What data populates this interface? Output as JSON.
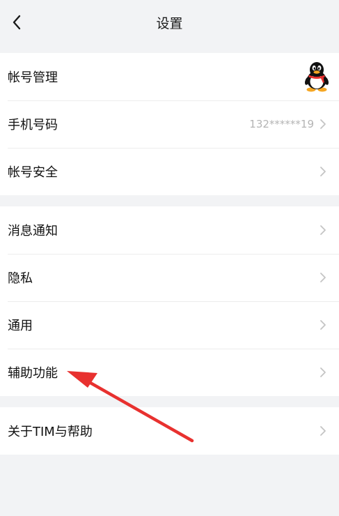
{
  "header": {
    "title": "设置",
    "back_icon": "chevron-left-icon"
  },
  "groups": [
    {
      "items": [
        {
          "label": "帐号管理",
          "value": "",
          "icon": "qq-penguin-avatar"
        },
        {
          "label": "手机号码",
          "value": "132******19",
          "icon": "chevron-right-icon"
        },
        {
          "label": "帐号安全",
          "value": "",
          "icon": "chevron-right-icon"
        }
      ]
    },
    {
      "items": [
        {
          "label": "消息通知",
          "value": "",
          "icon": "chevron-right-icon"
        },
        {
          "label": "隐私",
          "value": "",
          "icon": "chevron-right-icon"
        },
        {
          "label": "通用",
          "value": "",
          "icon": "chevron-right-icon"
        },
        {
          "label": "辅助功能",
          "value": "",
          "icon": "chevron-right-icon"
        }
      ]
    },
    {
      "items": [
        {
          "label": "关于TIM与帮助",
          "value": "",
          "icon": "chevron-right-icon"
        }
      ]
    }
  ],
  "annotation": {
    "type": "red-arrow",
    "points_to": "辅助功能",
    "color": "#e8312f"
  },
  "colors": {
    "background": "#f2f3f5",
    "row_background": "#ffffff",
    "value_text": "#b4b4b4",
    "chevron": "#c4c4c4"
  }
}
